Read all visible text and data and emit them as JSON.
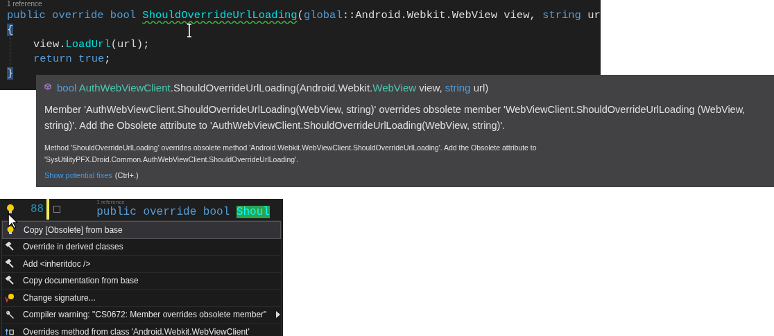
{
  "editor": {
    "codelens": "1 reference",
    "lines": [
      {
        "tokens": [
          {
            "text": "public override bool ",
            "kind": "keyword"
          },
          {
            "text": "ShouldOverrideUrlLoading",
            "kind": "method",
            "squiggle": true
          },
          {
            "text": "(",
            "kind": "plain"
          },
          {
            "text": "global",
            "kind": "keyword"
          },
          {
            "text": "::Android.Webkit.WebView view, ",
            "kind": "plain"
          },
          {
            "text": "string",
            "kind": "keyword"
          },
          {
            "text": " ur",
            "kind": "plain"
          }
        ]
      },
      {
        "tokens": [
          {
            "text": "{",
            "kind": "brace"
          }
        ],
        "children": [
          {
            "tokens": [
              {
                "text": "view.",
                "kind": "plain"
              },
              {
                "text": "LoadUrl",
                "kind": "method"
              },
              {
                "text": "(url);",
                "kind": "plain"
              }
            ]
          },
          {
            "tokens": [
              {
                "text": "return true",
                "kind": "keyword"
              },
              {
                "text": ";",
                "kind": "plain"
              }
            ]
          }
        ]
      },
      {
        "tokens": [
          {
            "text": "}",
            "kind": "brace"
          }
        ]
      }
    ]
  },
  "quickinfo": {
    "signature": [
      {
        "text": "bool ",
        "kind": "keyword"
      },
      {
        "text": "AuthWebViewClient",
        "kind": "type"
      },
      {
        "text": ".ShouldOverrideUrlLoading(Android.Webkit.",
        "kind": "plain"
      },
      {
        "text": "WebView",
        "kind": "type"
      },
      {
        "text": " view, ",
        "kind": "plain"
      },
      {
        "text": "string",
        "kind": "keyword"
      },
      {
        "text": " url)",
        "kind": "plain"
      }
    ],
    "message": "Member 'AuthWebViewClient.ShouldOverrideUrlLoading(WebView, string)' overrides obsolete member 'WebViewClient.ShouldOverrideUrlLoading (WebView, string)'. Add the Obsolete attribute to 'AuthWebViewClient.ShouldOverrideUrlLoading(WebView, string)'.",
    "detail": "Method 'ShouldOverrideUrlLoading' overrides obsolete method 'Android.Webkit.WebViewClient.ShouldOverrideUrlLoading'. Add the Obsolete attribute to 'SysUtilityPFX.Droid.Common.AuthWebViewClient.ShouldOverrideUrlLoading'.",
    "link": "Show potential fixes",
    "shortcut": "(Ctrl+.)"
  },
  "lightbulb": {
    "line_number": "88",
    "codelens": "1 reference",
    "code": "public override bool ",
    "highlight": "Shoul",
    "menu": [
      {
        "label": "Copy [Obsolete] from base",
        "kind": "bulb",
        "selected": true,
        "has_submenu": false
      },
      {
        "label": "Override in derived classes",
        "kind": "hammer",
        "selected": false,
        "has_submenu": false
      },
      {
        "label": "Add <inheritdoc />",
        "kind": "hammer",
        "selected": false,
        "has_submenu": false
      },
      {
        "label": "Copy documentation from base",
        "kind": "hammer",
        "selected": false,
        "has_submenu": false
      },
      {
        "label": "Change signature...",
        "kind": "signature",
        "selected": false,
        "has_submenu": false
      },
      {
        "label": "Compiler warning: \"CS0672: Member overrides obsolete member\"",
        "kind": "wrench",
        "selected": false,
        "has_submenu": true
      },
      {
        "label": "Overrides method from class 'Android.Webkit.WebViewClient'",
        "kind": "override",
        "selected": false,
        "has_submenu": false
      }
    ]
  }
}
